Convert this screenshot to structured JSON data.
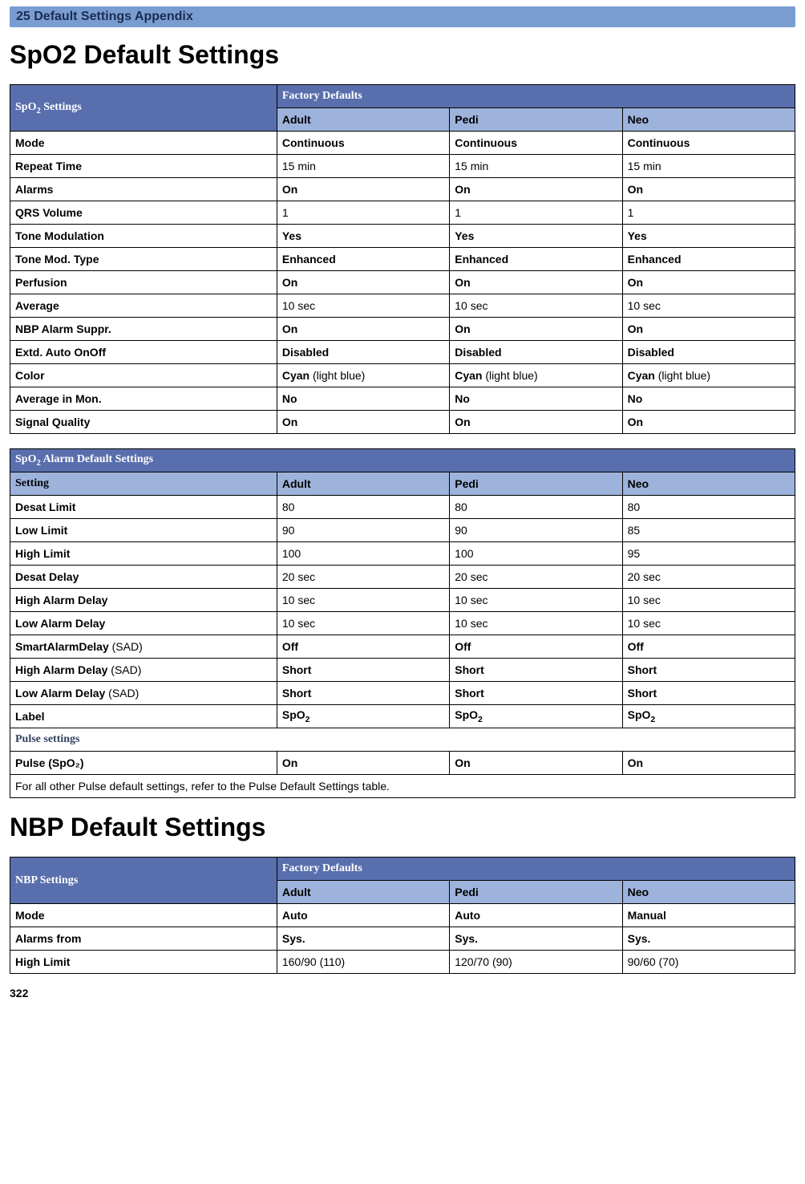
{
  "chapter": "25  Default Settings Appendix",
  "pageNum": "322",
  "section1": "SpO2 Default Settings",
  "section2": "NBP Default Settings",
  "t1": {
    "title": "SpO₂ Settings",
    "fd": "Factory Defaults",
    "cols": [
      "Adult",
      "Pedi",
      "Neo"
    ],
    "rows": [
      {
        "l": "Mode",
        "v": [
          "Continuous",
          "Continuous",
          "Continuous"
        ],
        "b": true
      },
      {
        "l": "Repeat Time",
        "v": [
          "15 min",
          "15 min",
          "15 min"
        ],
        "b": false
      },
      {
        "l": "Alarms",
        "v": [
          "On",
          "On",
          "On"
        ],
        "b": true
      },
      {
        "l": "QRS Volume",
        "v": [
          "1",
          "1",
          "1"
        ],
        "b": false
      },
      {
        "l": "Tone Modulation",
        "v": [
          "Yes",
          "Yes",
          "Yes"
        ],
        "b": true
      },
      {
        "l": "Tone Mod. Type",
        "v": [
          "Enhanced",
          "Enhanced",
          "Enhanced"
        ],
        "b": true
      },
      {
        "l": "Perfusion",
        "v": [
          "On",
          "On",
          "On"
        ],
        "b": true
      },
      {
        "l": "Average",
        "v": [
          "10 sec",
          "10 sec",
          "10 sec"
        ],
        "b": false
      },
      {
        "l": "NBP Alarm Suppr.",
        "v": [
          "On",
          "On",
          "On"
        ],
        "b": true
      },
      {
        "l": "Extd. Auto OnOff",
        "v": [
          "Disabled",
          "Disabled",
          "Disabled"
        ],
        "b": true
      },
      {
        "l": "Color",
        "v": [
          "Cyan (light blue)",
          "Cyan (light blue)",
          "Cyan (light blue)"
        ],
        "b": false,
        "mix": true
      },
      {
        "l": "Average in Mon.",
        "v": [
          "No",
          "No",
          "No"
        ],
        "b": true
      },
      {
        "l": "Signal Quality",
        "v": [
          "On",
          "On",
          "On"
        ],
        "b": true
      }
    ]
  },
  "t2": {
    "title": "SpO₂ Alarm Default Settings",
    "cols": [
      "Setting",
      "Adult",
      "Pedi",
      "Neo"
    ],
    "rows": [
      {
        "l": "Desat Limit",
        "v": [
          "80",
          "80",
          "80"
        ],
        "b": false
      },
      {
        "l": "Low Limit",
        "v": [
          "90",
          "90",
          "85"
        ],
        "b": false
      },
      {
        "l": "High Limit",
        "v": [
          "100",
          "100",
          "95"
        ],
        "b": false
      },
      {
        "l": "Desat Delay",
        "v": [
          "20 sec",
          "20 sec",
          "20 sec"
        ],
        "b": false
      },
      {
        "l": "High Alarm Delay",
        "v": [
          "10 sec",
          "10 sec",
          "10 sec"
        ],
        "b": false
      },
      {
        "l": "Low Alarm Delay",
        "v": [
          "10 sec",
          "10 sec",
          "10 sec"
        ],
        "b": false
      },
      {
        "l": "SmartAlarmDelay",
        "suffix": " (SAD)",
        "v": [
          "Off",
          "Off",
          "Off"
        ],
        "b": true
      },
      {
        "l": "High Alarm Delay",
        "suffix": " (SAD)",
        "v": [
          "Short",
          "Short",
          "Short"
        ],
        "b": true
      },
      {
        "l": "Low Alarm Delay",
        "suffix": " (SAD)",
        "v": [
          "Short",
          "Short",
          "Short"
        ],
        "b": true
      },
      {
        "l": "Label",
        "v": [
          "SpO₂",
          "SpO₂",
          "SpO₂"
        ],
        "b": true
      }
    ],
    "pulseHdr": "Pulse settings",
    "pulseRow": {
      "l": "Pulse (SpO₂)",
      "v": [
        "On",
        "On",
        "On"
      ]
    },
    "footer": "For all other Pulse default settings, refer to the Pulse Default Settings table."
  },
  "t3": {
    "title": "NBP Settings",
    "fd": "Factory Defaults",
    "cols": [
      "Adult",
      "Pedi",
      "Neo"
    ],
    "rows": [
      {
        "l": "Mode",
        "v": [
          "Auto",
          "Auto",
          "Manual"
        ],
        "b": true
      },
      {
        "l": "Alarms from",
        "v": [
          "Sys.",
          "Sys.",
          "Sys."
        ],
        "b": true
      },
      {
        "l": "High Limit",
        "v": [
          "160/90 (110)",
          "120/70 (90)",
          "90/60 (70)"
        ],
        "b": false
      }
    ]
  }
}
